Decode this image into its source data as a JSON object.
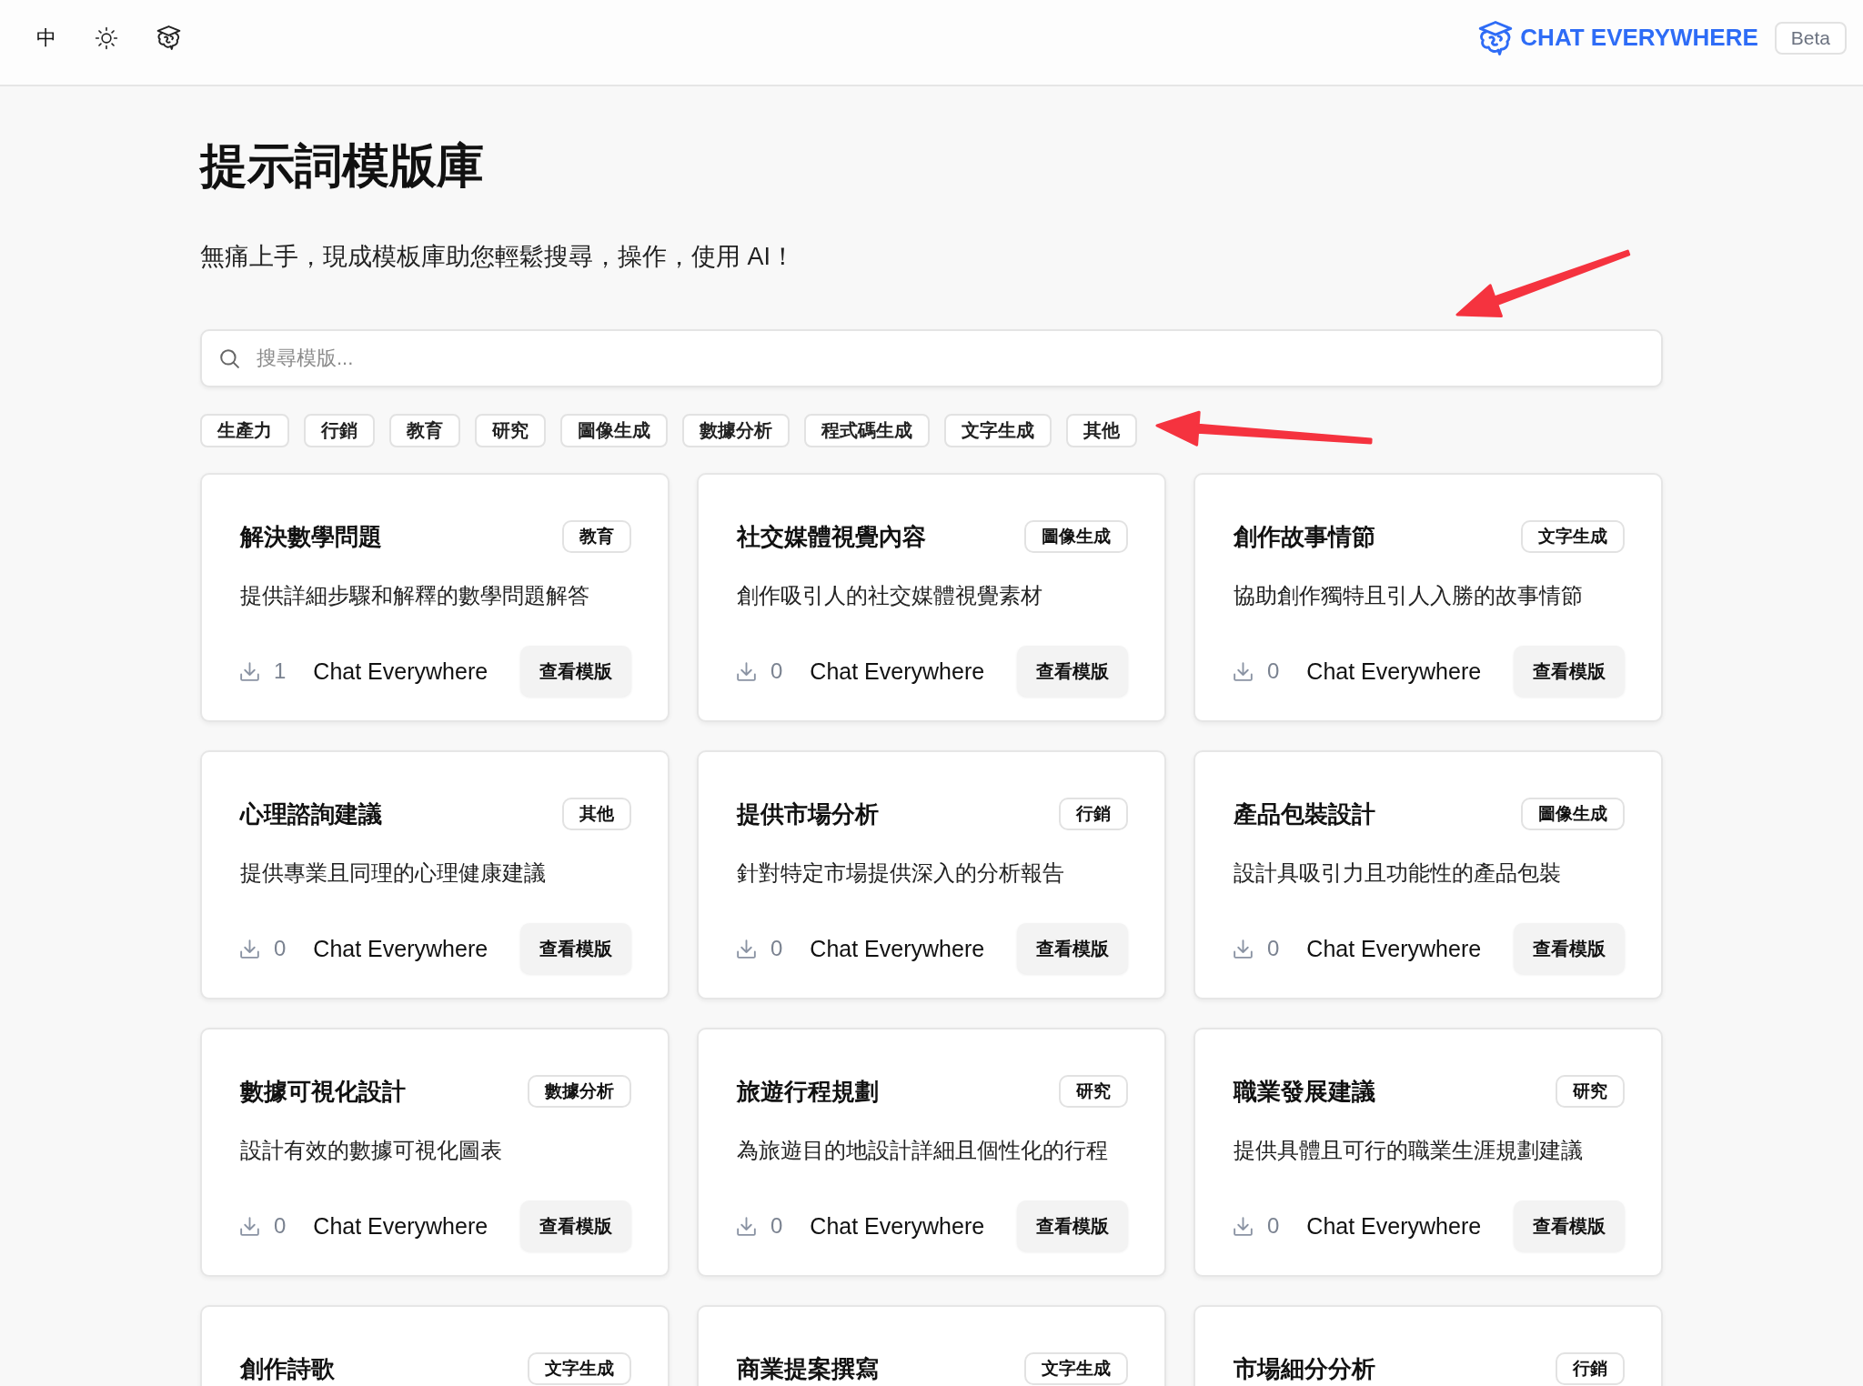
{
  "header": {
    "language_toggle": "中",
    "logo_text": "CHAT EVERYWHERE",
    "badge": "Beta"
  },
  "page": {
    "title": "提示詞模版庫",
    "subtitle": "無痛上手，現成模板庫助您輕鬆搜尋，操作，使用 AI！"
  },
  "search": {
    "placeholder": "搜尋模版..."
  },
  "categories": [
    {
      "label": "生產力",
      "selected": false
    },
    {
      "label": "行銷",
      "selected": false
    },
    {
      "label": "教育",
      "selected": false
    },
    {
      "label": "研究",
      "selected": false
    },
    {
      "label": "圖像生成",
      "selected": false
    },
    {
      "label": "數據分析",
      "selected": false
    },
    {
      "label": "程式碼生成",
      "selected": false
    },
    {
      "label": "文字生成",
      "selected": false
    },
    {
      "label": "其他",
      "selected": false
    }
  ],
  "templates": [
    {
      "title": "解決數學問題",
      "category": "教育",
      "description": "提供詳細步驟和解釋的數學問題解答",
      "downloads": "1",
      "author": "Chat Everywhere",
      "action": "查看模版"
    },
    {
      "title": "社交媒體視覺內容",
      "category": "圖像生成",
      "description": "創作吸引人的社交媒體視覺素材",
      "downloads": "0",
      "author": "Chat Everywhere",
      "action": "查看模版"
    },
    {
      "title": "創作故事情節",
      "category": "文字生成",
      "description": "協助創作獨特且引人入勝的故事情節",
      "downloads": "0",
      "author": "Chat Everywhere",
      "action": "查看模版"
    },
    {
      "title": "心理諮詢建議",
      "category": "其他",
      "description": "提供專業且同理的心理健康建議",
      "downloads": "0",
      "author": "Chat Everywhere",
      "action": "查看模版"
    },
    {
      "title": "提供市場分析",
      "category": "行銷",
      "description": "針對特定市場提供深入的分析報告",
      "downloads": "0",
      "author": "Chat Everywhere",
      "action": "查看模版"
    },
    {
      "title": "產品包裝設計",
      "category": "圖像生成",
      "description": "設計具吸引力且功能性的產品包裝",
      "downloads": "0",
      "author": "Chat Everywhere",
      "action": "查看模版"
    },
    {
      "title": "數據可視化設計",
      "category": "數據分析",
      "description": "設計有效的數據可視化圖表",
      "downloads": "0",
      "author": "Chat Everywhere",
      "action": "查看模版"
    },
    {
      "title": "旅遊行程規劃",
      "category": "研究",
      "description": "為旅遊目的地設計詳細且個性化的行程",
      "downloads": "0",
      "author": "Chat Everywhere",
      "action": "查看模版"
    },
    {
      "title": "職業發展建議",
      "category": "研究",
      "description": "提供具體且可行的職業生涯規劃建議",
      "downloads": "0",
      "author": "Chat Everywhere",
      "action": "查看模版"
    },
    {
      "title": "創作詩歌",
      "category": "文字生成"
    },
    {
      "title": "商業提案撰寫",
      "category": "文字生成"
    },
    {
      "title": "市場細分分析",
      "category": "行銷"
    }
  ]
}
